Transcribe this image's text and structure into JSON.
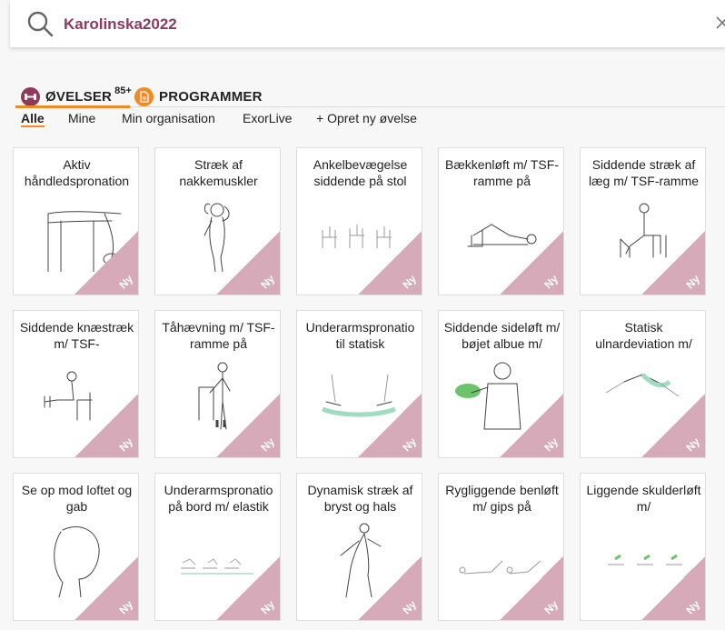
{
  "search": {
    "value": "Karolinska2022"
  },
  "type_tabs": {
    "ovelser_label": "ØVELSER",
    "ovelser_count": "85+",
    "programmer_label": "PROGRAMMER"
  },
  "filters": [
    "Alle",
    "Mine",
    "Min organisation",
    "ExorLive",
    "+ Opret ny øvelse"
  ],
  "badge_text": "Ny",
  "cards": [
    {
      "title": "Aktiv håndledspronation"
    },
    {
      "title": "Stræk af nakkemuskler"
    },
    {
      "title": "Ankelbevægelse siddende på stol"
    },
    {
      "title": "Bækkenløft m/ TSF-ramme på"
    },
    {
      "title": "Siddende stræk af læg m/ TSF-ramme"
    },
    {
      "title": "Siddende knæstræk m/ TSF-"
    },
    {
      "title": "Tåhævning m/ TSF-ramme på"
    },
    {
      "title": "Underarmspronatio til statisk"
    },
    {
      "title": "Siddende sideløft m/ bøjet albue m/"
    },
    {
      "title": "Statisk ulnardeviation m/"
    },
    {
      "title": "Se op mod loftet og gab"
    },
    {
      "title": "Underarmspronatio på bord m/ elastik"
    },
    {
      "title": "Dynamisk stræk af bryst og hals"
    },
    {
      "title": "Rygliggende benløft m/ gips på"
    },
    {
      "title": "Liggende skulderløft m/"
    }
  ]
}
